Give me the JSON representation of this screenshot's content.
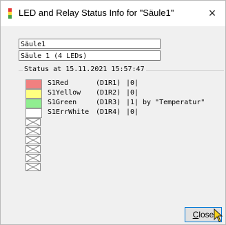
{
  "window": {
    "title": "LED and Relay Status Info for \"Säule1\"",
    "close_glyph": "×"
  },
  "fields": {
    "name_value": "Säule1",
    "description_value": "Säule 1 (4 LEDs)"
  },
  "status": {
    "label": "Status at 15.11.2021 15:57:47",
    "leds": [
      {
        "name": "S1Red",
        "pin": "(D1R1)",
        "state": "|0|",
        "by": "",
        "color": "#f08080"
      },
      {
        "name": "S1Yellow",
        "pin": "(D1R2)",
        "state": "|0|",
        "by": "",
        "color": "#ffff80"
      },
      {
        "name": "S1Green",
        "pin": "(D1R3)",
        "state": "|1|",
        "by": "by \"Temperatur\"",
        "color": "#90ee90"
      },
      {
        "name": "S1ErrWhite",
        "pin": "(D1R4)",
        "state": "|0|",
        "by": "",
        "color": "#ffffff"
      }
    ],
    "empty_slot_icon": "crossed-box-icon",
    "empty_slot_count": 6
  },
  "buttons": {
    "close_label_underlined": "C",
    "close_label_rest": "lose"
  },
  "icons": {
    "app": "traffic-light-icon",
    "cursor": "mouse-pointer-icon"
  },
  "colors": {
    "focus_border": "#0078d7"
  }
}
